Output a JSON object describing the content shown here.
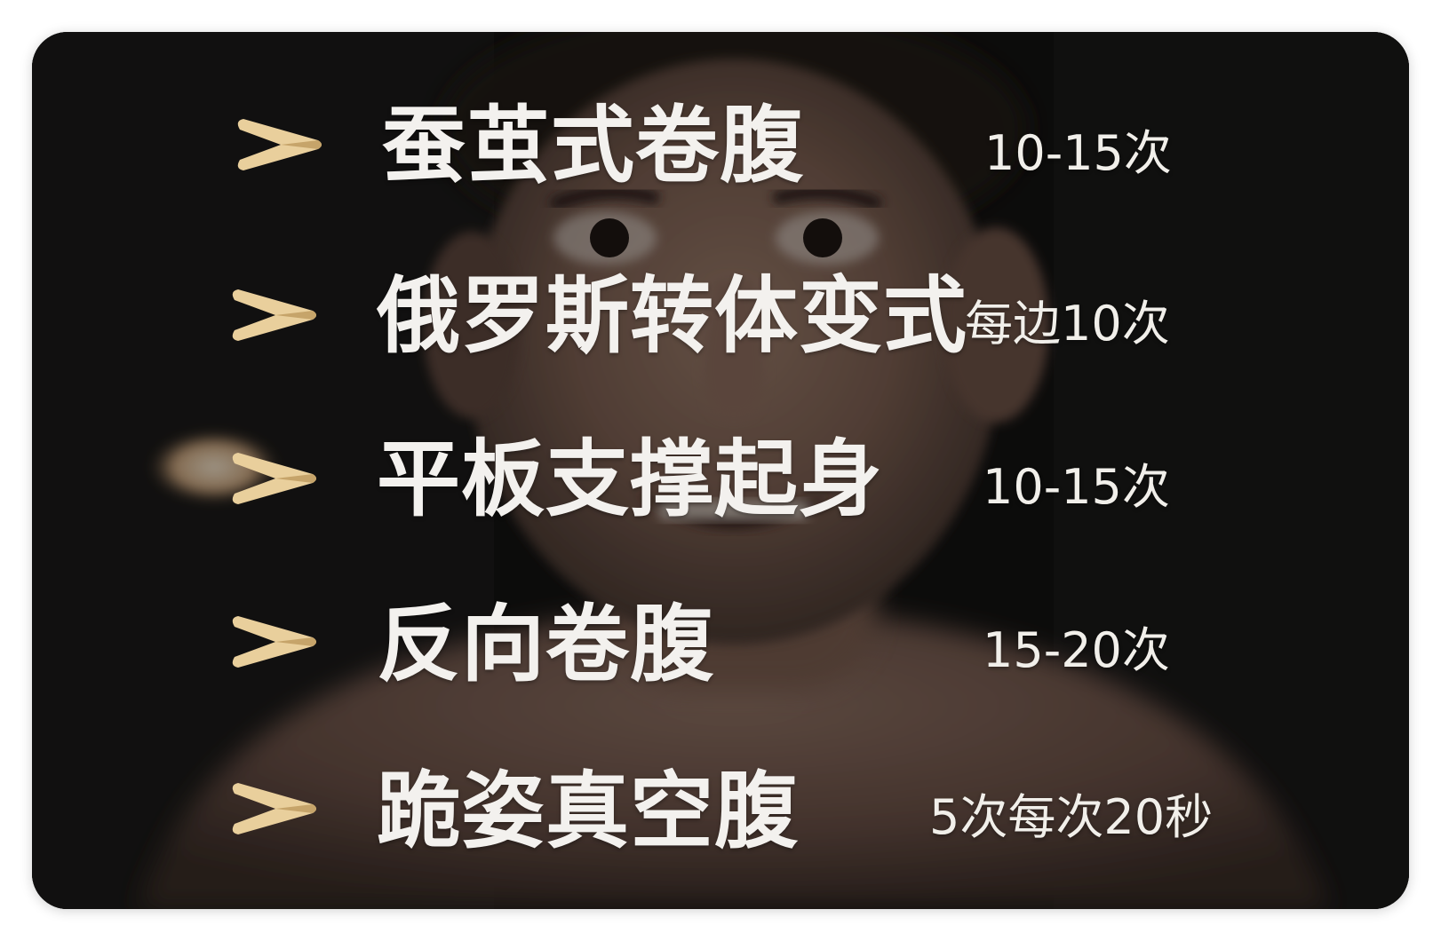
{
  "exercises": [
    {
      "name": "蚕茧式卷腹",
      "reps": "10-15次"
    },
    {
      "name": "俄罗斯转体变式",
      "reps": "每边10次"
    },
    {
      "name": "平板支撑起身",
      "reps": "10-15次"
    },
    {
      "name": "反向卷腹",
      "reps": "15-20次"
    },
    {
      "name": "跪姿真空腹",
      "reps": "5次每次20秒"
    }
  ],
  "colors": {
    "chevron_gold": "#e9cf9c",
    "chevron_gold_dark": "#c6a46a",
    "text": "#f3f1ee",
    "background": "#151414"
  },
  "icons": {
    "bullet": "chevron-right-icon"
  }
}
